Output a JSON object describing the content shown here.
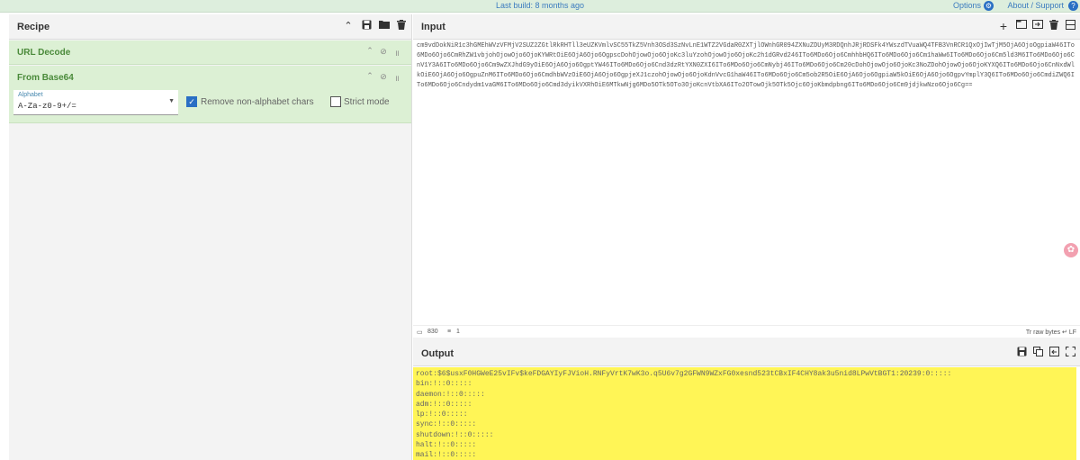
{
  "topbar": {
    "build_text": "Last build: 8 months ago",
    "options_label": "Options",
    "about_label": "About / Support"
  },
  "recipe": {
    "title": "Recipe",
    "operations": [
      {
        "title": "URL Decode"
      },
      {
        "title": "From Base64"
      }
    ],
    "alphabet": {
      "label": "Alphabet",
      "value": "A-Za-z0-9+/="
    },
    "remove_nonalpha_label": "Remove non-alphabet chars",
    "remove_nonalpha_checked": true,
    "strict_mode_label": "Strict mode",
    "strict_mode_checked": false
  },
  "input": {
    "title": "Input",
    "text": "cm9vdDokNiR1c3hGMEhWVzVFMjV2SUZ2ZGtlRkRHTll3eUZKVmlvSC55TkZ5Vnh3OSd3SzNvLnE1WTZ2VGdaR0ZXTjlOWnhGR094ZXNuZDUyM3RDQnhJRjRDSFk4YWszdTVuaWQ4TFB3VnRCR1QxOjIwTjM5OjA6OjoOgpiaW46ITo6MDo6Ojo6CmRhZW1vbjohOjowOjo6OjoKYWRtOiE6OjA6Ojo6OgpscDohOjowOjo6OjoKc3luYzohOjowOjo6OjoKc2h1dGRvd246ITo6MDo6Ojo6CmhhbHQ6ITo6MDo6Ojo6Cm1haWw6ITo6MDo6Ojo6Cm5ld3M6ITo6MDo6Ojo6CnV1Y3A6ITo6MDo6Ojo6Cm9wZXJhdG9yOiE6OjA6Ojo6OgptYW46ITo6MDo6Ojo6Cnd3dzRtYXN0ZXI6ITo6MDo6Ojo6CmNybj46ITo6MDo6Ojo6Cm20cDohOjowOjo6OjoKc3NoZDohOjowOjo6OjoKYXQ6ITo6MDo6Ojo6CnNxdWlkOiE6OjA6Ojo6OgpuZnM6ITo6MDo6Ojo6CmdhbWVzOiE6OjA6Ojo6OgpjeXJ1czohOjowOjo6OjoKdnVvcG1haW46ITo6MDo6Ojo6Cm5ob2R5OiE6OjA6Ojo6OgpiaW5kOiE6OjA6Ojo6OgpvYmplY3Q6ITo6MDo6Ojo6CmdiZWQ6ITo6MDo6Ojo6Cndydm1vaGM6ITo6MDo6Ojo6Cmd3dyikVXRhOiE6MTkwNjg6MDo5OTk5OTo3OjoKcnVtbXA6ITo2OTowOjk5OTk5Ojc6OjoKbmdpbng6ITo6MDo6Ojo6Cm9jdjkwNzo6Ojo6Cg==",
    "status_length": "830",
    "status_lines": "1",
    "status_right": "Tr raw bytes  ↵ LF"
  },
  "output": {
    "title": "Output",
    "lines": [
      "root:$6$usxF0HGWeE25vIFv$keFDGAYIyFJVioH.RNFyVrtK7wK3o.q5U6v7g2GFWN9WZxFG0xesnd523tCBxIF4CHY8ak3u5nid8LPwVtBGT1:20239:0:::::",
      "bin:!::0:::::",
      "daemon:!::0:::::",
      "adm:!::0:::::",
      "lp:!::0:::::",
      "sync:!::0:::::",
      "shutdown:!::0:::::",
      "halt:!::0:::::",
      "mail:!::0:::::"
    ]
  },
  "colors": {
    "accent": "#2a6fc4",
    "operation_bg": "#dcf0d4",
    "operation_title": "#4a8a3a",
    "output_highlight": "#fff556"
  },
  "icons": [
    "settings-gear-icon",
    "help-icon",
    "chevron-up-icon",
    "save-icon",
    "folder-icon",
    "trash-icon",
    "disable-icon",
    "pause-icon",
    "plus-icon",
    "new-tab-icon",
    "file-import-icon",
    "copy-icon",
    "expand-icon"
  ]
}
